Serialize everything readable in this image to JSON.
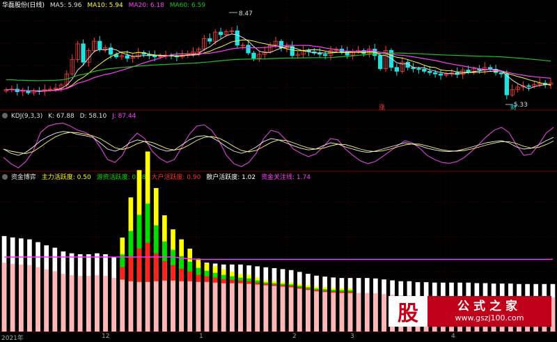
{
  "panel1": {
    "name": "华磊股份(日线)",
    "ma5": "MA5: 5.96",
    "ma10": "MA10: 5.94",
    "ma20": "MA20: 6.18",
    "ma60": "MA60: 6.59",
    "high_label": "8.47",
    "low_label": "5.33",
    "mark_zhang": "涨",
    "mark_cai": "财"
  },
  "panel2": {
    "name": "KDJ(9,3,3)",
    "k": "K: 67.88",
    "d": "D: 58.10",
    "j": "J: 87.44"
  },
  "panel3": {
    "name": "资金博弈",
    "a": "主力活跃度: 0.50",
    "b": "游资活跃度: 0.58",
    "c": "大户活跃度: 0.90",
    "d": "散户活跃度: 1.02",
    "e": "资金关注线: 1.74"
  },
  "watermark": {
    "logo": "股",
    "line1": "公式之家",
    "line2": "www.gszj100.com"
  },
  "colors": {
    "up": "#ff3c3c",
    "down": "#22e0e0",
    "ma5": "#e0e0e0",
    "ma10": "#ffff40",
    "ma20": "#ff40ff",
    "ma60": "#20c020",
    "grid": "#7a0000",
    "sep": "#7a0000",
    "retail": "#ffffff",
    "retail_fill": "#ffb6b6",
    "main": "#ffff00",
    "hot": "#00dd00",
    "big": "#ff2020",
    "focus": "#ff30ff"
  },
  "chart_data": [
    {
      "type": "candlestick",
      "title": "华磊股份(日线)",
      "series_labels": [
        "MA5: 5.96",
        "MA10: 5.94",
        "MA20: 6.18",
        "MA60: 6.59"
      ],
      "annotations": [
        "8.47",
        "5.33"
      ],
      "ylim": [
        5.0,
        8.7
      ],
      "close": [
        5.7,
        5.72,
        5.62,
        5.66,
        5.58,
        5.66,
        5.64,
        5.7,
        5.72,
        5.76,
        5.88,
        6.3,
        6.85,
        7.45,
        6.75,
        7.2,
        7.55,
        7.25,
        7.3,
        7.05,
        6.95,
        7.0,
        6.9,
        6.95,
        7.12,
        7.05,
        7.0,
        6.95,
        6.98,
        7.02,
        7.0,
        6.95,
        7.02,
        7.08,
        7.15,
        7.25,
        7.65,
        7.55,
        7.9,
        7.8,
        7.92,
        7.95,
        7.4,
        7.4,
        7.1,
        6.9,
        7.05,
        7.15,
        7.4,
        7.55,
        7.3,
        7.35,
        7.0,
        7.05,
        7.2,
        7.15,
        7.1,
        7.05,
        7.0,
        7.2,
        7.25,
        7.15,
        7.02,
        7.15,
        7.2,
        7.08,
        7.25,
        7.0,
        6.5,
        7.2,
        6.55,
        6.4,
        6.75,
        6.55,
        6.5,
        6.48,
        6.4,
        6.35,
        6.3,
        6.25,
        6.3,
        6.35,
        6.28,
        6.45,
        6.38,
        6.5,
        6.45,
        6.55,
        6.48,
        6.35,
        6.3,
        5.5,
        5.7,
        5.8,
        5.85,
        5.82,
        5.9,
        5.95,
        5.9,
        5.96
      ]
    },
    {
      "type": "line",
      "title": "KDJ(9,3,3)",
      "series_labels": [
        "K: 67.88",
        "D: 58.10",
        "J: 87.44"
      ],
      "ylim": [
        -10,
        110
      ],
      "k": [
        40,
        30,
        25,
        32,
        45,
        60,
        70,
        78,
        82,
        80,
        75,
        72,
        68,
        55,
        40,
        35,
        42,
        55,
        62,
        58,
        48,
        40,
        35,
        38,
        50,
        62,
        70,
        72,
        68,
        58,
        45,
        35,
        30,
        35,
        45,
        58,
        65,
        62,
        55,
        48,
        42,
        38,
        40,
        48,
        55,
        52,
        45,
        40,
        35,
        32,
        35,
        40,
        45,
        50,
        55,
        52,
        48,
        42,
        38,
        35,
        34,
        36,
        40,
        45,
        50,
        55,
        58,
        60,
        55,
        45,
        40,
        42,
        50,
        60,
        68
      ],
      "j": [
        20,
        5,
        -5,
        10,
        35,
        80,
        95,
        100,
        102,
        95,
        85,
        80,
        70,
        45,
        15,
        8,
        25,
        60,
        78,
        65,
        35,
        18,
        8,
        15,
        45,
        75,
        95,
        98,
        85,
        60,
        25,
        5,
        -2,
        8,
        30,
        65,
        85,
        80,
        62,
        40,
        30,
        22,
        28,
        45,
        65,
        62,
        40,
        25,
        12,
        5,
        10,
        22,
        35,
        48,
        60,
        55,
        42,
        25,
        15,
        8,
        6,
        10,
        20,
        35,
        52,
        70,
        85,
        92,
        80,
        50,
        25,
        28,
        50,
        78,
        92
      ]
    },
    {
      "type": "bar",
      "title": "资金博弈",
      "series_labels": [
        "主力活跃度: 0.50",
        "游资活跃度: 0.58",
        "大户活跃度: 0.90",
        "散户活跃度: 1.02",
        "资金关注线: 1.74"
      ],
      "ylim": [
        0,
        3.2
      ],
      "retail": [
        2.05,
        2.02,
        2.0,
        1.98,
        1.92,
        1.85,
        1.8,
        1.72,
        1.68,
        1.66,
        1.66,
        1.68,
        1.66,
        1.6,
        1.55,
        1.5,
        1.48,
        1.48,
        1.5,
        1.52,
        1.52,
        1.5,
        1.5,
        1.48,
        1.48,
        1.46,
        1.44,
        1.44,
        1.44,
        1.42,
        1.4,
        1.38,
        1.36,
        1.34,
        1.32,
        1.28,
        1.24,
        1.2,
        1.18,
        1.16,
        1.15,
        1.15,
        1.15,
        1.15,
        1.14,
        1.12,
        1.1,
        1.08,
        1.08,
        1.06,
        1.06,
        1.05,
        1.05,
        1.05,
        1.05,
        1.05,
        1.04,
        1.04,
        1.03,
        1.03,
        1.03,
        1.02,
        1.02,
        1.02,
        1.02,
        1.02
      ],
      "main": [
        0,
        0,
        0,
        0,
        0,
        0,
        0,
        0,
        0,
        0,
        0,
        0,
        0,
        0,
        0.9,
        1.8,
        2.4,
        2.8,
        2.0,
        1.4,
        1.1,
        0.9,
        0.7,
        0.5,
        0.4,
        0.35,
        0.3,
        0.25,
        0.2,
        0.2,
        0.15,
        0.1,
        0.1,
        0.1,
        0.1,
        0.1,
        0.1,
        0.1,
        0.1,
        0.1,
        0.1,
        0.1,
        0,
        0,
        0,
        0,
        0,
        0,
        0,
        0,
        0,
        0,
        0,
        0,
        0,
        0,
        0,
        0,
        0,
        0,
        0,
        0,
        0,
        0,
        0,
        0,
        0
      ],
      "focus": [
        1.6,
        1.6,
        1.6,
        1.6,
        1.6,
        1.6,
        1.6,
        1.6,
        1.6,
        1.6,
        1.6,
        1.6,
        1.6,
        1.6,
        1.6,
        1.6,
        1.6,
        1.6,
        1.6,
        1.6,
        1.6,
        1.58,
        1.56,
        1.55,
        1.55,
        1.55,
        1.55,
        1.55,
        1.55,
        1.55,
        1.55,
        1.55,
        1.55,
        1.55,
        1.55,
        1.55,
        1.55,
        1.55,
        1.55,
        1.55,
        1.55,
        1.55,
        1.55,
        1.55,
        1.55,
        1.55,
        1.55,
        1.55,
        1.55,
        1.55,
        1.55,
        1.55,
        1.55,
        1.55,
        1.55,
        1.55,
        1.55,
        1.55,
        1.55,
        1.55,
        1.55,
        1.55,
        1.55,
        1.55,
        1.55,
        1.55
      ]
    }
  ],
  "xaxis": [
    "2021年",
    "12",
    "1",
    "2",
    "3",
    "4"
  ]
}
